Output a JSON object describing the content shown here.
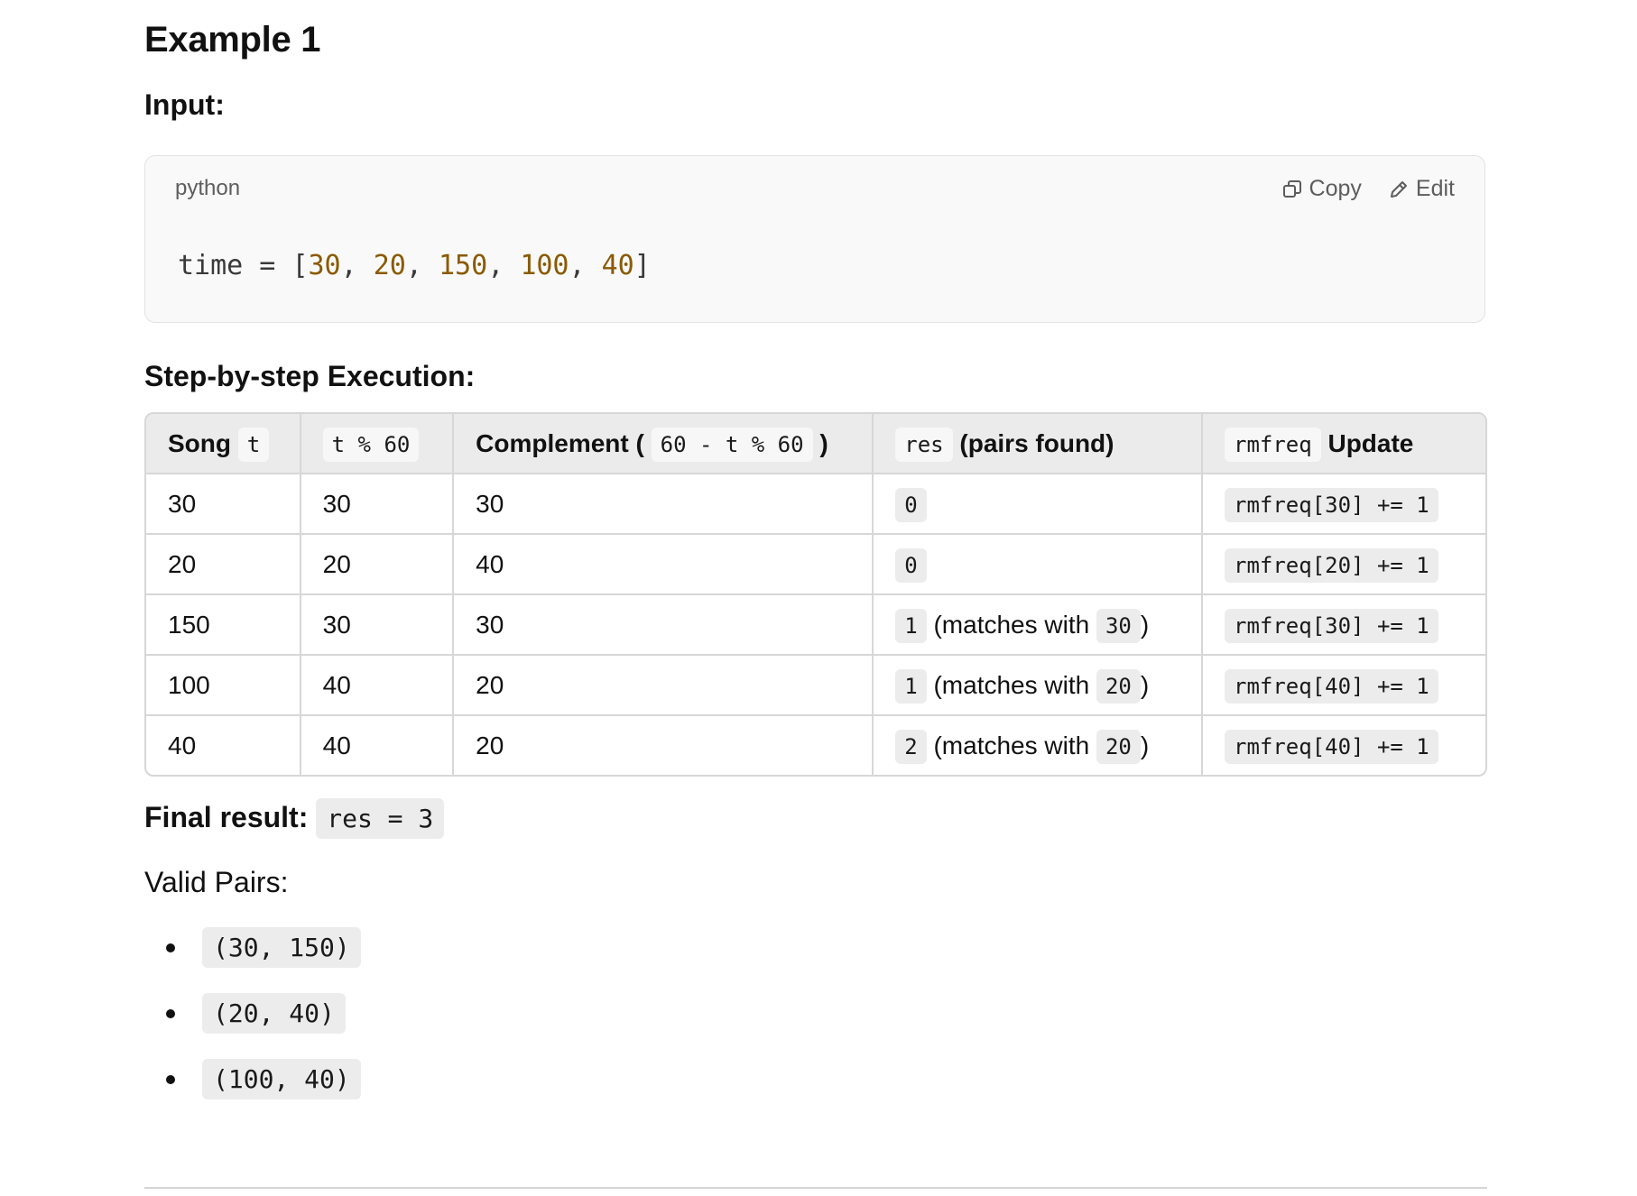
{
  "title": "Example 1",
  "input_heading": "Input:",
  "code": {
    "language": "python",
    "copy_label": "Copy",
    "edit_label": "Edit",
    "var": "time",
    "op": " = ",
    "open": "[",
    "close": "]",
    "sep": ", ",
    "values": [
      "30",
      "20",
      "150",
      "100",
      "40"
    ]
  },
  "step_heading": "Step-by-step Execution:",
  "table": {
    "headers": {
      "song_label": "Song",
      "song_code": "t",
      "mod_code": "t % 60",
      "complement_label": "Complement (",
      "complement_code": "60 - t % 60",
      "complement_close": ")",
      "res_code": "res",
      "res_label": "(pairs found)",
      "rmfreq_code": "rmfreq",
      "rmfreq_label": "Update"
    },
    "rows": [
      {
        "song": "30",
        "mod": "30",
        "complement": "30",
        "res": "0",
        "note": "",
        "match": "",
        "update": "rmfreq[30] += 1"
      },
      {
        "song": "20",
        "mod": "20",
        "complement": "40",
        "res": "0",
        "note": "",
        "match": "",
        "update": "rmfreq[20] += 1"
      },
      {
        "song": "150",
        "mod": "30",
        "complement": "30",
        "res": "1",
        "note": "(matches with",
        "match": "30",
        "update": "rmfreq[30] += 1"
      },
      {
        "song": "100",
        "mod": "40",
        "complement": "20",
        "res": "1",
        "note": "(matches with",
        "match": "20",
        "update": "rmfreq[40] += 1"
      },
      {
        "song": "40",
        "mod": "40",
        "complement": "20",
        "res": "2",
        "note": "(matches with",
        "match": "20",
        "update": "rmfreq[40] += 1"
      }
    ],
    "close_paren": ")"
  },
  "final": {
    "label": "Final result:",
    "code": "res = 3"
  },
  "valid_heading": "Valid Pairs:",
  "pairs": [
    "(30, 150)",
    "(20, 40)",
    "(100, 40)"
  ]
}
